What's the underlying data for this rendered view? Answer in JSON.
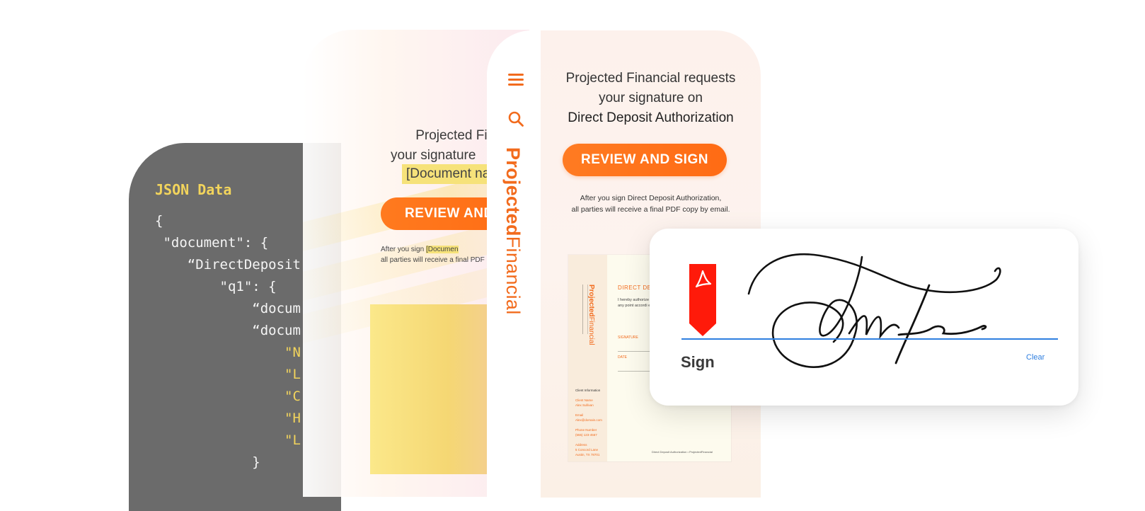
{
  "code_panel": {
    "title": "JSON Data",
    "lines": [
      "{",
      " \"document\": {",
      "    “DirectDeposit",
      "        \"q1\": {",
      "            “docum",
      "            “docum",
      "                \"N",
      "                \"L",
      "                \"C",
      "                \"H",
      "                \"L",
      "            }"
    ]
  },
  "ghost_phone": {
    "line1": "Projected Financial",
    "line2": "your signature",
    "doc_placeholder": "[Document na",
    "button": "REVIEW AND",
    "note_prefix": "After you sign",
    "note_mark": "[Documen",
    "note_line2": "all parties will receive a final PDF"
  },
  "phone": {
    "brand_bold": "Projected",
    "brand_light": "Financial",
    "request_line1": "Projected Financial requests",
    "request_line2": "your signature on",
    "document_name": "Direct Deposit Authorization",
    "review_button": "REVIEW AND SIGN",
    "note_line1": "After you sign Direct Deposit Authorization,",
    "note_line2": "all parties will receive a final PDF copy by email.",
    "preview": {
      "heading": "DIRECT DEPOS",
      "body": "I hereby authorize credit entries for th understand that I any point accordi electronic transac",
      "signature_field": "SIGNATURE",
      "date_field": "DATE",
      "client_heading": "Client Information",
      "client_name": "Client Name",
      "client_name_value": "Alex Sullivan",
      "email_label": "Email",
      "email_value": "Alex@domain.com",
      "phone_label": "Phone Number",
      "phone_value": "(555) 123-4567",
      "address_label": "Address",
      "address_value": "5 Concord Lane",
      "address_line2": "Austin, TX 78701",
      "footer": "Direct Deposit Authorization  •  ProjectedFinancial"
    }
  },
  "sign_card": {
    "tag_label": "Sign",
    "label": "Sign",
    "clear": "Clear",
    "accent_color": "#2f7fe0",
    "tag_color": "#ff1a0a"
  },
  "colors": {
    "brand_orange": "#f26b1d",
    "code_bg": "#6b6b6b",
    "code_keyword": "#f2d45c"
  }
}
